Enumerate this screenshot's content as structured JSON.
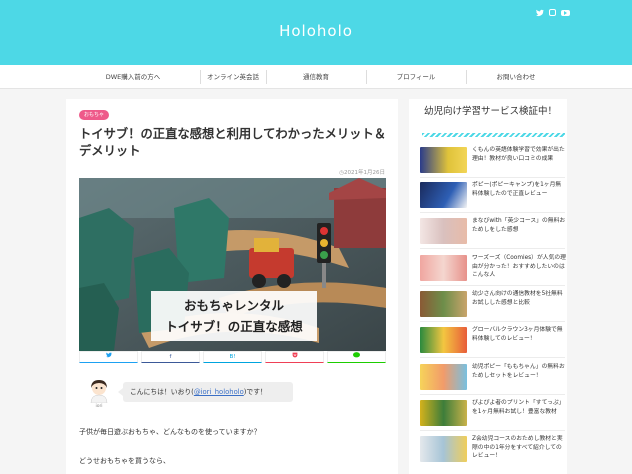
{
  "header": {
    "site_title": "Holoholo",
    "social_icons": [
      "twitter-icon",
      "instagram-icon",
      "youtube-icon"
    ],
    "bg_color": "#4dd8e6"
  },
  "nav": {
    "items": [
      "DWE購入前の方へ",
      "オンライン英会話",
      "通信教育",
      "プロフィール",
      "お問い合わせ"
    ]
  },
  "post": {
    "category": "おもちゃ",
    "title": "トイサブ！の正直な感想と利用してわかったメリット＆デメリット",
    "date": "2021年1月26日",
    "hero_caption_line1": "おもちゃレンタル",
    "hero_caption_line2": "トイサブ！の正直な感想",
    "share": [
      {
        "icon": "twitter-icon",
        "label": "",
        "color": "#1da1f2"
      },
      {
        "icon": "facebook-icon",
        "label": "f",
        "color": "#3b5998"
      },
      {
        "icon": "hatena-icon",
        "label": "B!",
        "color": "#00a4de"
      },
      {
        "icon": "pocket-icon",
        "label": "",
        "color": "#ef4056"
      },
      {
        "icon": "line-icon",
        "label": "",
        "color": "#1dcd00"
      }
    ],
    "avatar_label": "iori",
    "greeting_prefix": "こんにちは！いおり(",
    "greeting_link": "@iori_holoholo",
    "greeting_suffix": ")です！",
    "para1": "子供が毎日遊ぶおもちゃ、どんなものを使っていますか？",
    "para2": "どうせおもちゃを買うなら、"
  },
  "sidebar": {
    "title": "幼児向け学習サービス検証中！",
    "items": [
      "くもんの英語体験学習で効果が出た理由！教材が良い口コミの成果",
      "ポピー(ポピーキャンプ)を1ヶ月無料体験したので正直レビュー",
      "まなびwith「英少コース」の無料おためしをした感想",
      "ワーズーズ（Coomies）が人気の理由が分かった！おすすめしたいのはこんな人",
      "幼少さん向けの通信教材を5社無料お試しした感想と比較",
      "グローバルクラウン3ヶ月体験で無料体験してのレビュー！",
      "幼児ポピー「ももちゃん」の無料おためしセットをレビュー！",
      "ぴよぴよ者のプリント「すてっぷ」を1ヶ月無料お試し！豊富な教材",
      "Z会幼児コースのおためし教材と実際の中の1年分をすべて紹介してのレビュー！"
    ]
  }
}
